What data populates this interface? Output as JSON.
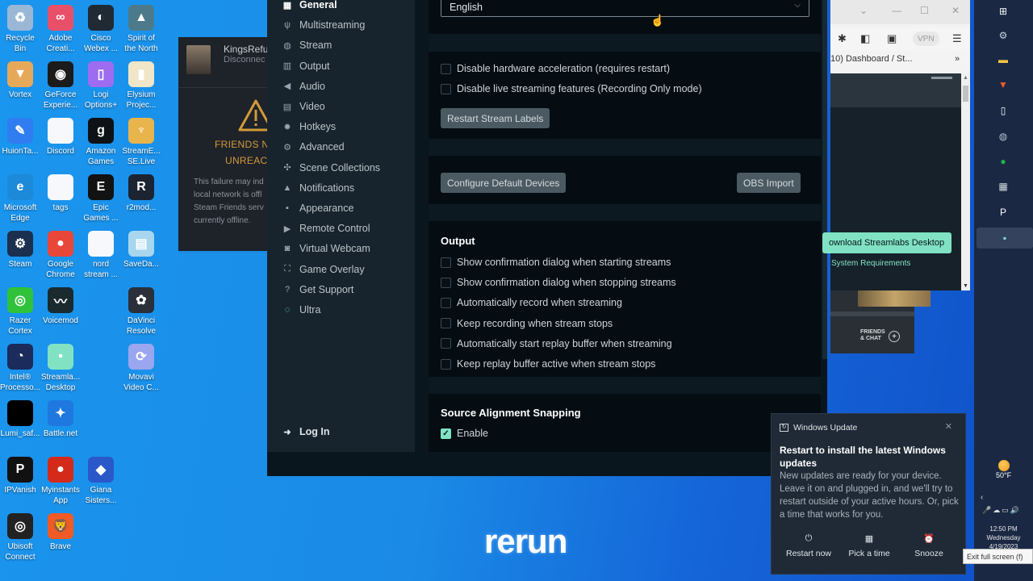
{
  "desktop": {
    "icons": [
      {
        "label": "Recycle\nBin",
        "icon": "recycle-bin-icon",
        "color": "#9bb7d6",
        "glyph": "♻"
      },
      {
        "label": "Adobe\nCreati...",
        "icon": "adobe-creative-cloud-icon",
        "color": "#e8506a",
        "glyph": "∞"
      },
      {
        "label": "Cisco\nWebex ...",
        "icon": "cisco-webex-icon",
        "color": "#1f2a34",
        "glyph": "◐"
      },
      {
        "label": "Spirit of\nthe North",
        "icon": "spirit-of-the-north-icon",
        "color": "#4c7a8a",
        "glyph": "▲"
      },
      {
        "label": "Vortex",
        "icon": "vortex-icon",
        "color": "#e6a95a",
        "glyph": "▼"
      },
      {
        "label": "GeForce\nExperie...",
        "icon": "geforce-experience-icon",
        "color": "#1b1b1b",
        "glyph": "◉"
      },
      {
        "label": "Logi\nOptions+",
        "icon": "logi-options-icon",
        "color": "#9d6cf0",
        "glyph": "▯"
      },
      {
        "label": "Elysium\nProjec...",
        "icon": "elysium-project-icon",
        "color": "#f0e6c8",
        "glyph": "▮"
      },
      {
        "label": "HuionTa...",
        "icon": "huion-tablet-icon",
        "color": "#2f7df0",
        "glyph": "✎"
      },
      {
        "label": "Discord",
        "icon": "discord-file-icon",
        "color": "#f6f8fb",
        "glyph": ""
      },
      {
        "label": "Amazon\nGames",
        "icon": "amazon-games-icon",
        "color": "#0e1116",
        "glyph": "g"
      },
      {
        "label": "StreamE...\nSE.Live",
        "icon": "streamelements-icon",
        "color": "#e8b44c",
        "glyph": "♆"
      },
      {
        "label": "Microsoft\nEdge",
        "icon": "microsoft-edge-icon",
        "color": "#1c8ad8",
        "glyph": "e"
      },
      {
        "label": "tags",
        "icon": "tags-file-icon",
        "color": "#f6f8fb",
        "glyph": ""
      },
      {
        "label": "Epic\nGames ...",
        "icon": "epic-games-icon",
        "color": "#121212",
        "glyph": "E"
      },
      {
        "label": "r2mod...",
        "icon": "r2modman-icon",
        "color": "#1c2432",
        "glyph": "R"
      },
      {
        "label": "Steam",
        "icon": "steam-icon",
        "color": "#1b2f4e",
        "glyph": "⚙"
      },
      {
        "label": "Google\nChrome",
        "icon": "google-chrome-icon",
        "color": "#e9463a",
        "glyph": "●"
      },
      {
        "label": "nord\nstream ...",
        "icon": "nordstream-file-icon",
        "color": "#f6f8fb",
        "glyph": ""
      },
      {
        "label": "SaveDa...",
        "icon": "savedata-icon",
        "color": "#a7d6ee",
        "glyph": "▤"
      },
      {
        "label": "Razer\nCortex",
        "icon": "razer-cortex-icon",
        "color": "#2fc23a",
        "glyph": "◎"
      },
      {
        "label": "Voicemod",
        "icon": "voicemod-icon",
        "color": "#1a2a2e",
        "glyph": "〰"
      },
      {
        "label": "DaVinci\nResolve",
        "icon": "davinci-resolve-icon",
        "color": "#2a2f3a",
        "glyph": "✿"
      },
      {
        "label": "Intel®\nProcesso...",
        "icon": "intel-processor-icon",
        "color": "#1a2b5c",
        "glyph": "◔"
      },
      {
        "label": "Streamla...\nDesktop",
        "icon": "streamlabs-desktop-icon",
        "color": "#80e2c3",
        "glyph": "▪"
      },
      {
        "label": "Movavi\nVideo C...",
        "icon": "movavi-video-icon",
        "color": "#9aa6ef",
        "glyph": "⟳"
      },
      {
        "label": "Lumi_saf...",
        "icon": "lumi-file-icon",
        "color": "#000000",
        "glyph": ""
      },
      {
        "label": "Battle.net",
        "icon": "battlenet-icon",
        "color": "#1e78e0",
        "glyph": "✦"
      },
      {
        "label": "IPVanish",
        "icon": "ipvanish-icon",
        "color": "#111111",
        "glyph": "P"
      },
      {
        "label": "Myinstants\nApp",
        "icon": "myinstants-icon",
        "color": "#d42a1a",
        "glyph": "●"
      },
      {
        "label": "Giana\nSisters...",
        "icon": "giana-sisters-icon",
        "color": "#2b58c8",
        "glyph": "◆"
      },
      {
        "label": "Ubisoft\nConnect",
        "icon": "ubisoft-connect-icon",
        "color": "#222222",
        "glyph": "◎"
      },
      {
        "label": "Brave",
        "icon": "brave-icon",
        "color": "#f05a24",
        "glyph": "🦁"
      }
    ]
  },
  "steam_friends": {
    "username": "KingsRefu",
    "status": "Disconnec",
    "error_line1": "FRIENDS NE",
    "error_line2": "UNREACH",
    "body": "This failure may ind\nlocal network is offl\nSteam Friends serv\ncurrently offline."
  },
  "streamlabs": {
    "sidebar": {
      "items": [
        {
          "label": "General",
          "icon": "general-grid-icon",
          "glyph": "▦",
          "active": true
        },
        {
          "label": "Multistreaming",
          "icon": "multistreaming-icon",
          "glyph": "ψ"
        },
        {
          "label": "Stream",
          "icon": "globe-icon",
          "glyph": "◍"
        },
        {
          "label": "Output",
          "icon": "output-chip-icon",
          "glyph": "▥"
        },
        {
          "label": "Audio",
          "icon": "speaker-icon",
          "glyph": "◀"
        },
        {
          "label": "Video",
          "icon": "film-icon",
          "glyph": "▤"
        },
        {
          "label": "Hotkeys",
          "icon": "gear-icon",
          "glyph": "✹"
        },
        {
          "label": "Advanced",
          "icon": "gears-icon",
          "glyph": "⚙"
        },
        {
          "label": "Scene Collections",
          "icon": "scene-collections-icon",
          "glyph": "✣"
        },
        {
          "label": "Notifications",
          "icon": "bell-icon",
          "glyph": "▲"
        },
        {
          "label": "Appearance",
          "icon": "appearance-icon",
          "glyph": "▪"
        },
        {
          "label": "Remote Control",
          "icon": "play-circle-icon",
          "glyph": "▶"
        },
        {
          "label": "Virtual Webcam",
          "icon": "camera-icon",
          "glyph": "◙"
        },
        {
          "label": "Game Overlay",
          "icon": "game-overlay-icon",
          "glyph": "⛶"
        },
        {
          "label": "Get Support",
          "icon": "help-icon",
          "glyph": "?"
        },
        {
          "label": "Ultra",
          "icon": "ultra-icon",
          "glyph": "◌"
        }
      ],
      "login_label": "Log In"
    },
    "general": {
      "language_value": "English",
      "hw_accel_label": "Disable hardware acceleration (requires restart)",
      "hw_accel_checked": false,
      "disable_live_label": "Disable live streaming features (Recording Only mode)",
      "disable_live_checked": false,
      "restart_labels_button": "Restart Stream Labels",
      "configure_devices_button": "Configure Default Devices",
      "obs_import_button": "OBS Import"
    },
    "output": {
      "title": "Output",
      "options": [
        {
          "label": "Show confirmation dialog when starting streams",
          "checked": false
        },
        {
          "label": "Show confirmation dialog when stopping streams",
          "checked": false
        },
        {
          "label": "Automatically record when streaming",
          "checked": false
        },
        {
          "label": "Keep recording when stream stops",
          "checked": false
        },
        {
          "label": "Automatically start replay buffer when streaming",
          "checked": false
        },
        {
          "label": "Keep replay buffer active when stream stops",
          "checked": false
        }
      ]
    },
    "snapping": {
      "title": "Source Alignment Snapping",
      "enable_label": "Enable",
      "enable_checked": true
    }
  },
  "browser": {
    "vpn_label": "VPN",
    "tab_title": "10) Dashboard / St...",
    "download_button": "ownload Streamlabs Desktop",
    "system_requirements_link": "System Requirements"
  },
  "steam_mini": {
    "friends_chat_label": "FRIENDS\n& CHAT"
  },
  "taskbar": {
    "apps": [
      {
        "icon": "windows-start-icon",
        "glyph": "⊞",
        "color": "#ffffff"
      },
      {
        "icon": "steam-taskbar-icon",
        "glyph": "⚙",
        "color": "#c6d4df"
      },
      {
        "icon": "file-explorer-icon",
        "glyph": "▬",
        "color": "#f6c445"
      },
      {
        "icon": "brave-taskbar-icon",
        "glyph": "▼",
        "color": "#f05a24"
      },
      {
        "icon": "notepad-icon",
        "glyph": "▯",
        "color": "#ffffff"
      },
      {
        "icon": "obs-icon",
        "glyph": "◍",
        "color": "#b7c0cc"
      },
      {
        "icon": "green-app-icon",
        "glyph": "●",
        "color": "#24b24a"
      },
      {
        "icon": "network-app-icon",
        "glyph": "▦",
        "color": "#d8dde3"
      },
      {
        "icon": "ipvanish-taskbar-icon",
        "glyph": "P",
        "color": "#ffffff"
      },
      {
        "icon": "streamlabs-taskbar-icon",
        "glyph": "▪",
        "color": "#80e2c3"
      }
    ],
    "temperature": "50°F",
    "time": "12:50 PM",
    "day": "Wednesday",
    "date": "4/19/2023"
  },
  "tooltip": {
    "text": "Exit full screen (f)"
  },
  "toast": {
    "app_name": "Windows Update",
    "title": "Restart to install the latest Windows updates",
    "body": "New updates are ready for your device. Leave it on and plugged in, and we'll try to restart outside of your active hours. Or, pick a time that works for you.",
    "actions": [
      {
        "label": "Restart now",
        "icon": "power-icon",
        "glyph": "⏻"
      },
      {
        "label": "Pick a time",
        "icon": "calendar-clock-icon",
        "glyph": "▦"
      },
      {
        "label": "Snooze",
        "icon": "alarm-clock-icon",
        "glyph": "⏰"
      }
    ]
  },
  "watermark": {
    "text": "rerun"
  }
}
